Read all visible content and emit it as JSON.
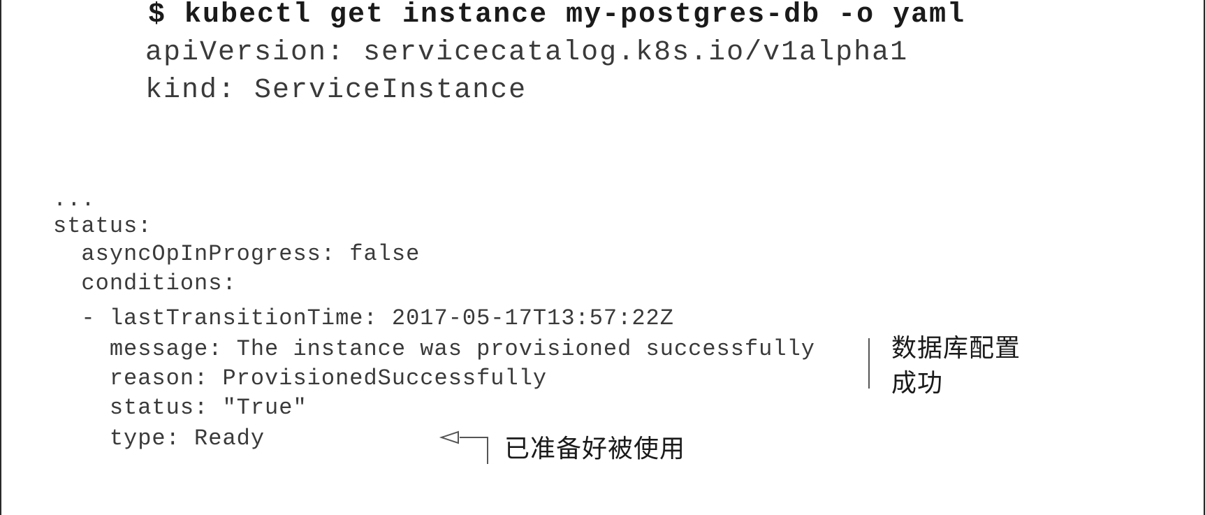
{
  "code": {
    "command": "$ kubectl get instance my-postgres-db -o yaml",
    "api_version": "apiVersion: servicecatalog.k8s.io/v1alpha1",
    "kind": "kind: ServiceInstance",
    "ellipsis": "...",
    "status": "status:",
    "async_op": "  asyncOpInProgress: false",
    "conditions": "  conditions:",
    "last_transition": "  - lastTransitionTime: 2017-05-17T13:57:22Z",
    "message": "    message: The instance was provisioned successfully",
    "reason": "    reason: ProvisionedSuccessfully",
    "status_true": "    status: \"True\"",
    "type_ready": "    type: Ready"
  },
  "annotations": {
    "db_provisioned_line1": "数据库配置",
    "db_provisioned_line2": "成功",
    "ready_to_use": "已准备好被使用"
  }
}
